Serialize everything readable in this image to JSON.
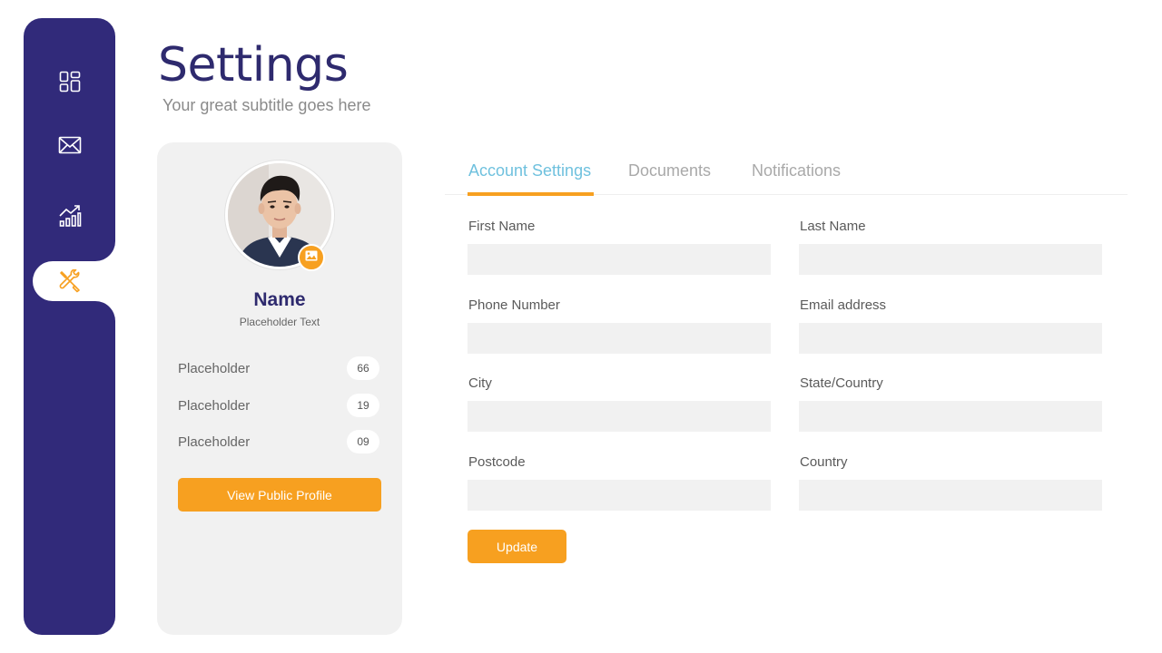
{
  "header": {
    "title": "Settings",
    "subtitle": "Your great subtitle goes here"
  },
  "sidebar": {
    "items": [
      {
        "icon": "dashboard-icon",
        "active": false
      },
      {
        "icon": "mail-icon",
        "active": false
      },
      {
        "icon": "analytics-icon",
        "active": false
      },
      {
        "icon": "tools-icon",
        "active": true
      }
    ]
  },
  "profile": {
    "name": "Name",
    "subtitle": "Placeholder Text",
    "stats": [
      {
        "label": "Placeholder",
        "value": "66"
      },
      {
        "label": "Placeholder",
        "value": "19"
      },
      {
        "label": "Placeholder",
        "value": "09"
      }
    ],
    "button_label": "View Public Profile"
  },
  "tabs": [
    {
      "label": "Account Settings",
      "active": true
    },
    {
      "label": "Documents",
      "active": false
    },
    {
      "label": "Notifications",
      "active": false
    }
  ],
  "form": {
    "fields": [
      {
        "label": "First Name",
        "value": ""
      },
      {
        "label": "Last Name",
        "value": ""
      },
      {
        "label": "Phone Number",
        "value": ""
      },
      {
        "label": "Email address",
        "value": ""
      },
      {
        "label": "City",
        "value": ""
      },
      {
        "label": "State/Country",
        "value": ""
      },
      {
        "label": "Postcode",
        "value": ""
      },
      {
        "label": "Country",
        "value": ""
      }
    ],
    "submit_label": "Update"
  },
  "colors": {
    "sidebar": "#312a7a",
    "accent": "#f7a020",
    "active_tab": "#6fc1de",
    "title": "#2e2a6e",
    "card": "#f1f1f1"
  }
}
